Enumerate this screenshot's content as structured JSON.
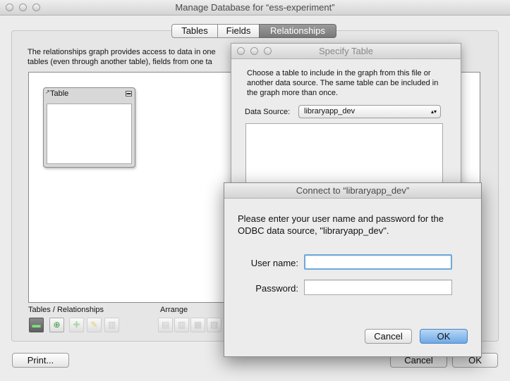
{
  "main_window": {
    "title": "Manage Database for “ess-experiment”",
    "tabs": [
      {
        "label": "Tables",
        "selected": false
      },
      {
        "label": "Fields",
        "selected": false
      },
      {
        "label": "Relationships",
        "selected": true
      }
    ],
    "description_line1": "The relationships graph provides access to data in one",
    "description_line2": "tables (even through another table), fields from one ta",
    "table_box_title": "Table",
    "tables_relationships_label": "Tables / Relationships",
    "arrange_label": "Arrange",
    "print_button": "Print...",
    "cancel_button": "Cancel",
    "ok_button": "OK"
  },
  "specify_table": {
    "title": "Specify Table",
    "instructions": "Choose a table to include in the graph from this file or another data source.  The same table can be included in the graph more than once.",
    "data_source_label": "Data Source:",
    "data_source_value": "libraryapp_dev"
  },
  "connect_dialog": {
    "title": "Connect to “libraryapp_dev”",
    "message": "Please enter your user name and password for the ODBC data source, \"libraryapp_dev\".",
    "username_label": "User name:",
    "username_value": "",
    "password_label": "Password:",
    "password_value": "",
    "cancel_button": "Cancel",
    "ok_button": "OK"
  },
  "colors": {
    "default_button": "#7fb4ea",
    "focus_ring": "#6fa8dc"
  }
}
